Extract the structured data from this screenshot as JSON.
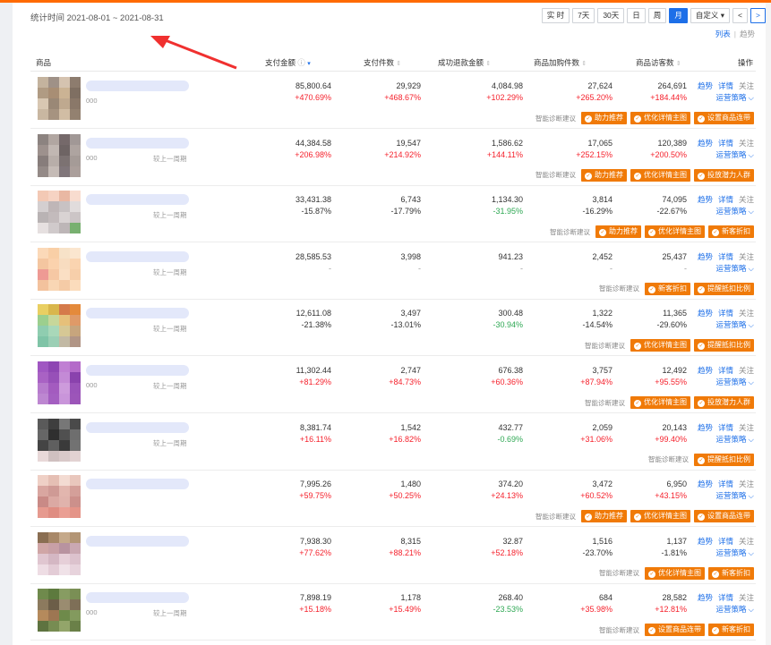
{
  "header": {
    "range_label": "统计时间 2021-08-01 ~ 2021-08-31",
    "time_buttons": [
      {
        "label": "实 时",
        "active": false
      },
      {
        "label": "7天",
        "active": false
      },
      {
        "label": "30天",
        "active": false
      },
      {
        "label": "日",
        "active": false
      },
      {
        "label": "周",
        "active": false
      },
      {
        "label": "月",
        "active": true
      },
      {
        "label": "自定义",
        "active": false
      }
    ],
    "prev_arrow": "<",
    "next_arrow": ">",
    "view_list": "列表",
    "view_trend": "趋势"
  },
  "columns": {
    "product": "商品",
    "pay_amount": "支付金额",
    "pay_count": "支付件数",
    "refund_amount": "成功退款金额",
    "cart_count": "商品加购件数",
    "visitors": "商品访客数",
    "ops": "操作"
  },
  "ops": {
    "trend": "趋势",
    "detail": "详情",
    "follow": "关注",
    "strategy": "运营策略",
    "suggest": "智能诊断建议"
  },
  "rows": [
    {
      "code": "000",
      "cmp": "",
      "pay": "85,800.64",
      "pay_r": "+470.69%",
      "cnt": "29,929",
      "cnt_r": "+468.67%",
      "ref": "4,084.98",
      "ref_r": "+102.29%",
      "cart": "27,624",
      "cart_r": "+265.20%",
      "vis": "264,691",
      "vis_r": "+184.44%",
      "btns": [
        "助力推荐",
        "优化详情主图",
        "设置商品连带"
      ],
      "colors": [
        "#c4b39e",
        "#9f9187",
        "#d5c3b0",
        "#8d7c6e",
        "#b09b83",
        "#a88e74",
        "#cbb394",
        "#7f6f62",
        "#d8c7b2",
        "#9a8876",
        "#bfa98f",
        "#8a7869",
        "#c9b7a1",
        "#a69380",
        "#d1bda4",
        "#938170"
      ]
    },
    {
      "code": "000",
      "cmp": "较上一周期",
      "pay": "44,384.58",
      "pay_r": "+206.98%",
      "cnt": "19,547",
      "cnt_r": "+214.92%",
      "ref": "1,586.62",
      "ref_r": "+144.11%",
      "cart": "17,065",
      "cart_r": "+252.15%",
      "vis": "120,389",
      "vis_r": "+200.50%",
      "btns": [
        "助力推荐",
        "优化详情主图",
        "投放潜力人群"
      ],
      "colors": [
        "#8c8380",
        "#b1a6a1",
        "#75696a",
        "#a19896",
        "#9d918d",
        "#c1b7b2",
        "#6e6464",
        "#aea4a0",
        "#877d7b",
        "#b8aea9",
        "#7c7272",
        "#a59b97",
        "#948a87",
        "#c5bbb6",
        "#80767a",
        "#ab9f9b"
      ]
    },
    {
      "code": "",
      "cmp": "较上一周期",
      "pay": "33,431.38",
      "pay_r": "-15.87%",
      "cnt": "6,743",
      "cnt_r": "-17.79%",
      "ref": "1,134.30",
      "ref_r": "-31.95%",
      "cart": "3,814",
      "cart_r": "-16.29%",
      "vis": "74,095",
      "vis_r": "-22.67%",
      "btns": [
        "助力推荐",
        "优化详情主图",
        "新客折扣"
      ],
      "colors": [
        "#f3c9b5",
        "#f6d3c3",
        "#e9b8a3",
        "#f8dccf",
        "#d4cfd0",
        "#bfb6b7",
        "#c8c2c3",
        "#e1dcdc",
        "#b9b3b4",
        "#c3bbbc",
        "#d9d3d3",
        "#ccc5c6",
        "#e6e0e0",
        "#d0cacb",
        "#bdb6b7",
        "#78b070"
      ]
    },
    {
      "code": "",
      "cmp": "较上一周期",
      "pay": "28,585.53",
      "pay_r": "-",
      "cnt": "3,998",
      "cnt_r": "-",
      "ref": "941.23",
      "ref_r": "-",
      "cart": "2,452",
      "cart_r": "-",
      "vis": "25,437",
      "vis_r": "-",
      "btns": [
        "新客折扣",
        "提醒抵扣比例"
      ],
      "colors": [
        "#fbd9b8",
        "#f9cfa6",
        "#f7e2c8",
        "#fbe6cf",
        "#f4c6a0",
        "#fbd2ad",
        "#f8dcc0",
        "#fad4b0",
        "#ee9a94",
        "#f6c8a4",
        "#fadfc4",
        "#f7cfaa",
        "#f3c29d",
        "#f9d6b4",
        "#f5cba6",
        "#fbdcbc"
      ]
    },
    {
      "code": "",
      "cmp": "较上一周期",
      "pay": "12,611.08",
      "pay_r": "-21.38%",
      "cnt": "3,497",
      "cnt_r": "-13.01%",
      "ref": "300.48",
      "ref_r": "-30.94%",
      "cart": "1,322",
      "cart_r": "-14.54%",
      "vis": "11,365",
      "vis_r": "-29.60%",
      "btns": [
        "优化详情主图",
        "提醒抵扣比例"
      ],
      "colors": [
        "#e9cf62",
        "#d9b64c",
        "#d57a4a",
        "#e48a3b",
        "#9ccf8e",
        "#c7d79a",
        "#e6c07a",
        "#df9a68",
        "#8fcdb0",
        "#a9d8b9",
        "#d6c895",
        "#c7a57d",
        "#7fc4a7",
        "#9bcfb5",
        "#c2b9a4",
        "#b19586"
      ]
    },
    {
      "code": "000",
      "cmp": "较上一周期",
      "pay": "11,302.44",
      "pay_r": "+81.29%",
      "cnt": "2,747",
      "cnt_r": "+84.73%",
      "ref": "676.38",
      "ref_r": "+60.36%",
      "cart": "3,757",
      "cart_r": "+87.94%",
      "vis": "12,492",
      "vis_r": "+95.55%",
      "btns": [
        "优化详情主图",
        "投放潜力人群"
      ],
      "colors": [
        "#a057c2",
        "#8e46b3",
        "#c07fd3",
        "#b46ac9",
        "#a962c4",
        "#9750b8",
        "#c48ad6",
        "#8a42ad",
        "#b77ccd",
        "#a35bbf",
        "#cd9bdc",
        "#9a53b9",
        "#bd87d1",
        "#a45fc1",
        "#c995da",
        "#9c55b9"
      ]
    },
    {
      "code": "",
      "cmp": "较上一周期",
      "pay": "8,381.74",
      "pay_r": "+16.11%",
      "cnt": "1,542",
      "cnt_r": "+16.82%",
      "ref": "432.77",
      "ref_r": "-0.69%",
      "cart": "2,059",
      "cart_r": "+31.06%",
      "vis": "20,143",
      "vis_r": "+99.40%",
      "btns": [
        "提醒抵扣比例"
      ],
      "colors": [
        "#5a5a5a",
        "#3e3e3e",
        "#777",
        "#4a4a4a",
        "#666",
        "#2f2f2f",
        "#505050",
        "#6e6e6e",
        "#444",
        "#5f5f5f",
        "#3a3a3a",
        "#727272",
        "#e8d8d8",
        "#cfc0c0",
        "#d9c9c9",
        "#e2d2d2"
      ]
    },
    {
      "code": "",
      "cmp": "",
      "pay": "7,995.26",
      "pay_r": "+59.75%",
      "cnt": "1,480",
      "cnt_r": "+50.25%",
      "ref": "374.20",
      "ref_r": "+24.13%",
      "cart": "3,472",
      "cart_r": "+60.52%",
      "vis": "6,950",
      "vis_r": "+43.15%",
      "btns": [
        "助力推荐",
        "优化详情主图",
        "设置商品连带"
      ],
      "colors": [
        "#efd0c6",
        "#e5bfb4",
        "#f3dbd2",
        "#e9c7bd",
        "#d9a6a0",
        "#cf9a95",
        "#e2b6ae",
        "#d49f99",
        "#c98a86",
        "#dba9a3",
        "#e0b3ac",
        "#cc908b",
        "#e69a8f",
        "#df8d82",
        "#ea9f94",
        "#e49488"
      ]
    },
    {
      "code": "",
      "cmp": "",
      "pay": "7,938.30",
      "pay_r": "+77.62%",
      "cnt": "8,315",
      "cnt_r": "+88.21%",
      "ref": "32.87",
      "ref_r": "+52.18%",
      "cart": "1,516",
      "cart_r": "-23.70%",
      "vis": "1,137",
      "vis_r": "-1.81%",
      "btns": [
        "优化详情主图",
        "新客折扣"
      ],
      "colors": [
        "#8a6e52",
        "#a88868",
        "#c5a98a",
        "#b39575",
        "#d0a6a6",
        "#c8a0a6",
        "#b893a0",
        "#caa8b2",
        "#e0c6d0",
        "#d4b7c3",
        "#e6cfd8",
        "#dcc2cd",
        "#eedde4",
        "#e3ccd6",
        "#f0e2e8",
        "#e7d3dc"
      ]
    },
    {
      "code": "000",
      "cmp": "较上一周期",
      "pay": "7,898.19",
      "pay_r": "+15.18%",
      "cnt": "1,178",
      "cnt_r": "+15.49%",
      "ref": "268.40",
      "ref_r": "-23.53%",
      "cart": "684",
      "cart_r": "+35.98%",
      "vis": "28,582",
      "vis_r": "+12.81%",
      "btns": [
        "设置商品连带",
        "新客折扣"
      ],
      "colors": [
        "#6f8a4c",
        "#5d7a3e",
        "#879c62",
        "#7a8f55",
        "#8c7a5e",
        "#6c5e48",
        "#9a8c70",
        "#7e6f57",
        "#b58a5c",
        "#9d7652",
        "#6e8a4a",
        "#839a5e",
        "#5e7340",
        "#778c52",
        "#93a56a",
        "#6a8048"
      ]
    }
  ]
}
